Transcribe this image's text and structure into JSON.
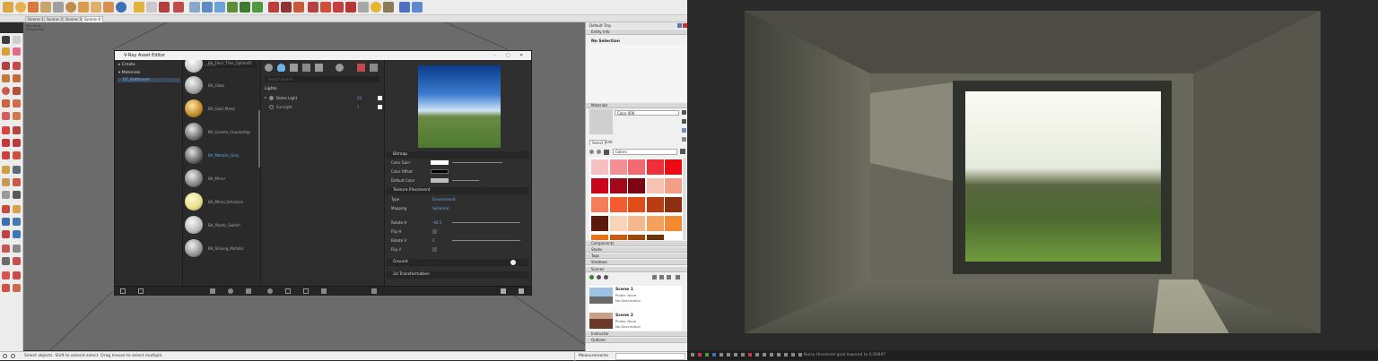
{
  "scenes": [
    "Scene 1",
    "Scene 2",
    "Scene 3",
    "Scene 4"
  ],
  "viewport": {
    "label_line1": "Two Point",
    "label_line2": "Perspective"
  },
  "asset_editor": {
    "title": "V-Ray Asset Editor",
    "tree": {
      "create": "Create",
      "materials": "Materials",
      "selected": "07_Bathroom"
    },
    "search_library": "Search Library",
    "materials": [
      "BA_Floor_Tiles_Option01",
      "BA_Glass",
      "BA_Gold_Metal",
      "BA_Granite_Countertop",
      "BA_Metallic_Grey",
      "BA_Mirror",
      "BA_Mirror_Emissive",
      "BA_Plastic_Switch",
      "BA_Shining_Metallic"
    ],
    "search_scene": "Search Scene",
    "lights_header": "Lights",
    "lights": [
      {
        "name": "Dome Light",
        "value": "20"
      },
      {
        "name": "SunLight",
        "value": "1"
      }
    ],
    "bitmap": "Bitmap",
    "color_gain": "Color Gain",
    "color_offset": "Color Offset",
    "default_color": "Default Color",
    "texture_placement": "Texture Placement",
    "type_label": "Type",
    "type_value": "Environment",
    "mapping_label": "Mapping",
    "mapping_value": "Spherical",
    "rotate_h_label": "Rotate H",
    "rotate_h_value": "-94.5",
    "flip_h_label": "Flip H",
    "rotate_v_label": "Rotate V",
    "rotate_v_value": "0",
    "flip_v_label": "Flip V",
    "ground": "Ground",
    "transformation": "2d Transformation"
  },
  "tray": {
    "title": "Default Tray",
    "entity_info": "Entity Info",
    "no_selection": "No Selection",
    "materials_hdr": "Materials",
    "color_name": "Color 006",
    "select_tab": "Select",
    "edit_tab": "Edit",
    "library": "Colors",
    "swatches": [
      "#f6c0c3",
      "#f48f95",
      "#f26a6f",
      "#ef2f3a",
      "#ed0a12",
      "#c8081a",
      "#a2071a",
      "#7c0514",
      "#f7c4b4",
      "#f39f88",
      "#f47d5a",
      "#f35d2d",
      "#e04d19",
      "#b93c13",
      "#8c2f10",
      "#5c1a0a",
      "#f8d4b8",
      "#f6b98b",
      "#f4a15d",
      "#f18a33",
      "#e8731a",
      "#c55e12",
      "#9a480e",
      "#6b330a"
    ],
    "sections_a": [
      "Components",
      "Styles",
      "Tags",
      "Shadows"
    ],
    "scenes_hdr": "Scenes",
    "scene_items": [
      {
        "name": "Scene 1",
        "photo": "Photo: None",
        "desc": "No Description"
      },
      {
        "name": "Scene 2",
        "photo": "Photo: None",
        "desc": "No Description"
      }
    ],
    "sections_b": [
      "Instructor",
      "Outliner"
    ]
  },
  "status": {
    "hint": "Select objects. Shift to extend select. Drag mouse to select multiple.",
    "measurements": "Measurements"
  },
  "render_status": "Noise threshold goal lowered to 0.00497"
}
